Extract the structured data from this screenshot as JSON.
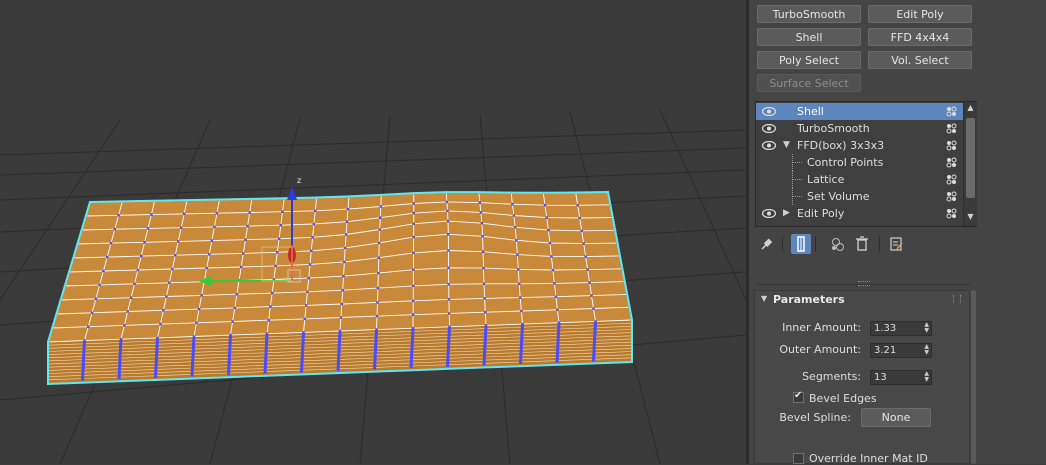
{
  "modifier_buttons": [
    {
      "label": "TurboSmooth",
      "enabled": true
    },
    {
      "label": "Edit Poly",
      "enabled": true
    },
    {
      "label": "Shell",
      "enabled": true
    },
    {
      "label": "FFD 4x4x4",
      "enabled": true
    },
    {
      "label": "Poly Select",
      "enabled": true
    },
    {
      "label": "Vol. Select",
      "enabled": true
    },
    {
      "label": "Surface Select",
      "enabled": false
    }
  ],
  "stack": [
    {
      "label": "Shell",
      "selected": true,
      "eye": true,
      "arrow": "",
      "level": 0
    },
    {
      "label": "TurboSmooth",
      "selected": false,
      "eye": true,
      "arrow": "",
      "level": 0
    },
    {
      "label": "FFD(box) 3x3x3",
      "selected": false,
      "eye": true,
      "arrow": "▼",
      "level": 0
    },
    {
      "label": "Control Points",
      "selected": false,
      "eye": false,
      "arrow": "",
      "level": 1
    },
    {
      "label": "Lattice",
      "selected": false,
      "eye": false,
      "arrow": "",
      "level": 1
    },
    {
      "label": "Set Volume",
      "selected": false,
      "eye": false,
      "arrow": "",
      "level": 1
    },
    {
      "label": "Edit Poly",
      "selected": false,
      "eye": true,
      "arrow": "▶",
      "level": 0
    }
  ],
  "toolbar": {
    "icons": [
      "pin-stack-icon",
      "show-end-result-icon",
      "make-unique-icon",
      "remove-modifier-icon",
      "configure-modifier-sets-icon"
    ],
    "active": "show-end-result-icon"
  },
  "parameters": {
    "title": "Parameters",
    "inner_amount_label": "Inner Amount:",
    "inner_amount": "1.33",
    "outer_amount_label": "Outer Amount:",
    "outer_amount": "3.21",
    "segments_label": "Segments:",
    "segments": "13",
    "bevel_edges_label": "Bevel Edges",
    "bevel_edges": true,
    "bevel_spline_label": "Bevel Spline:",
    "bevel_spline_value": "None",
    "override_inner_label": "Override Inner Mat ID",
    "override_inner": false
  },
  "viewport": {
    "gizmo_axis_label": "z",
    "colors": {
      "background": "#3a3a3a",
      "grid": "#2a2a2a",
      "mesh_top": "#c8893a",
      "mesh_side": "#b97a2e",
      "wire": "#ffffff",
      "vertex": "#4a4aff",
      "selection_outline": "#5ee8f0",
      "axis_x": "#2ecc40",
      "axis_y": "#e53935",
      "axis_z": "#2f3bd8"
    }
  }
}
